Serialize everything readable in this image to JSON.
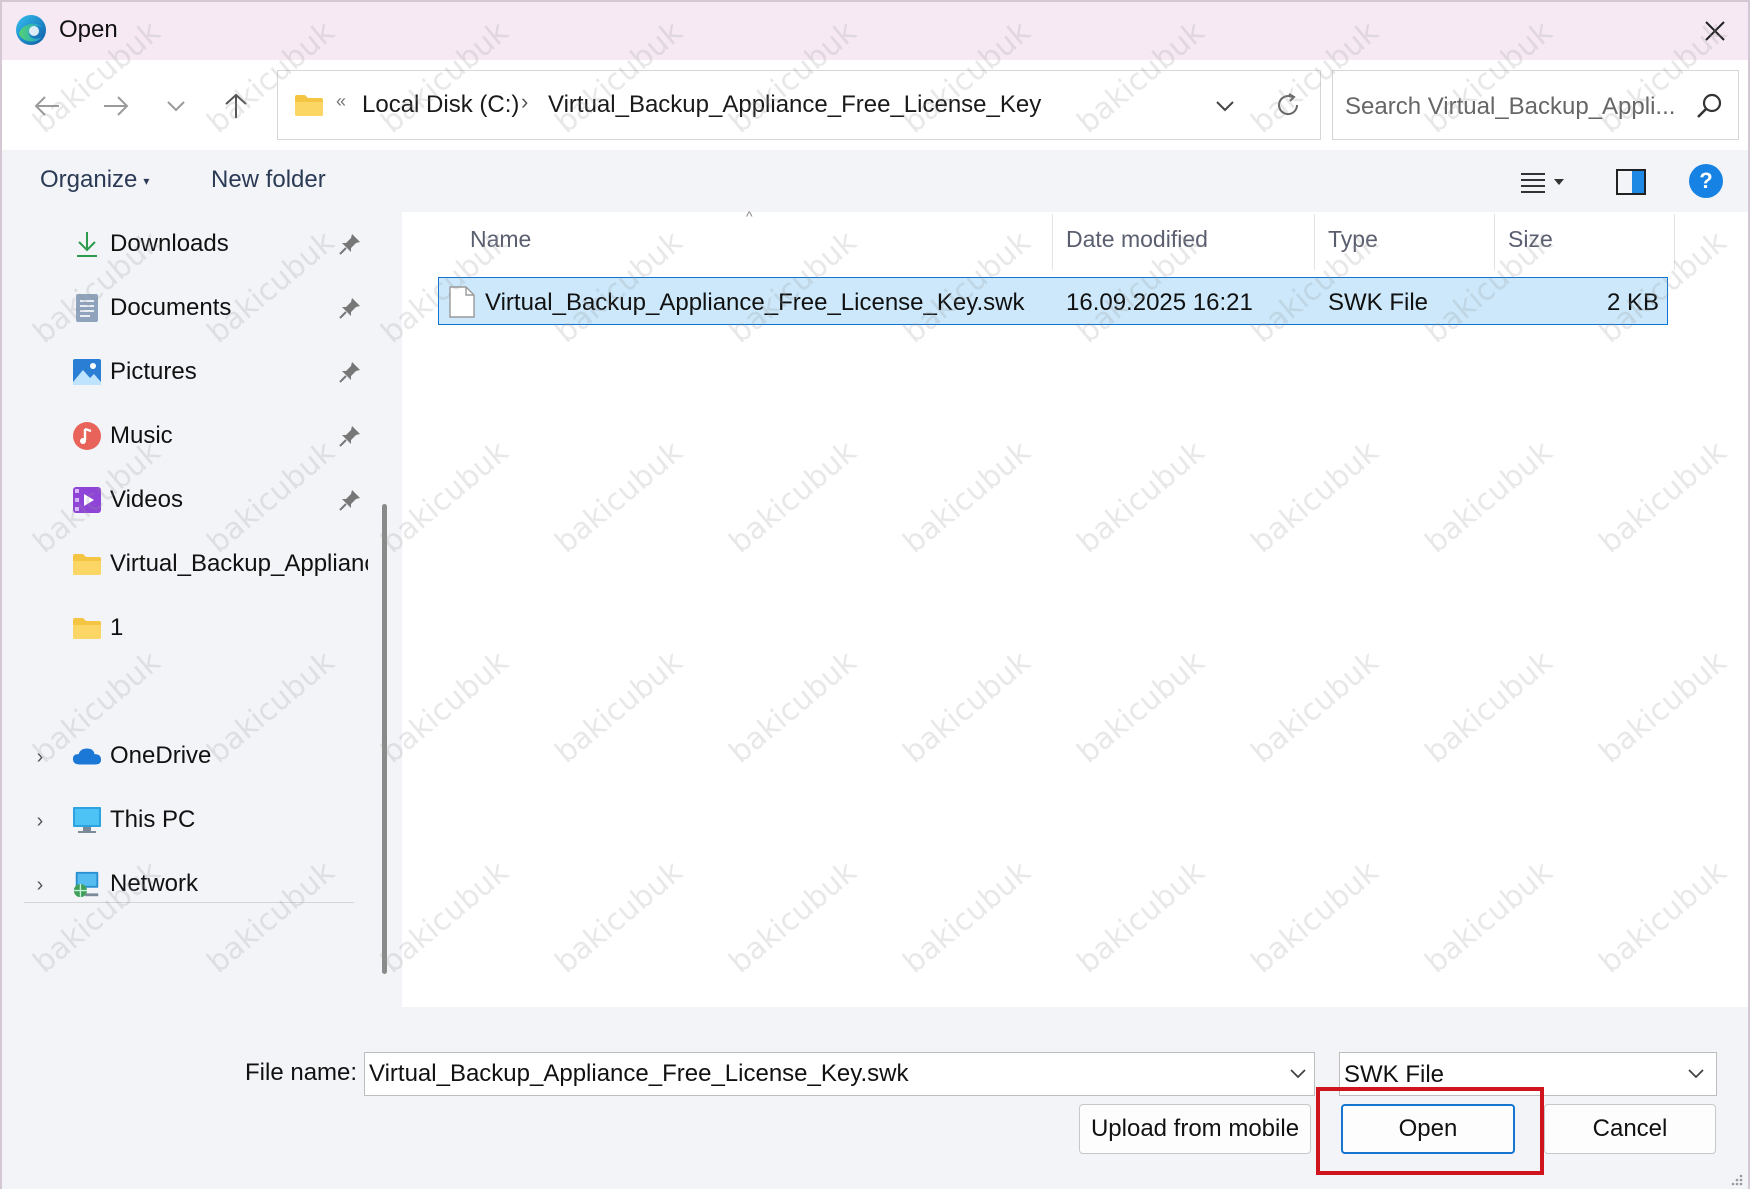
{
  "window": {
    "title": "Open",
    "app_icon": "edge-browser-icon"
  },
  "nav": {
    "back_icon": "arrow-left-icon",
    "forward_icon": "arrow-right-icon",
    "recent_icon": "chevron-down-icon",
    "up_icon": "arrow-up-icon"
  },
  "address": {
    "overflow": "«",
    "crumbs": [
      "Local Disk (C:)",
      "Virtual_Backup_Appliance_Free_License_Key"
    ],
    "separator": "›"
  },
  "search": {
    "placeholder": "Search Virtual_Backup_Appli..."
  },
  "toolbar": {
    "organize_label": "Organize",
    "organize_caret": "▾",
    "new_folder_label": "New folder",
    "help_label": "?"
  },
  "sidebar": {
    "quick_access": [
      {
        "label": "Downloads",
        "icon": "download-icon",
        "pinned": true
      },
      {
        "label": "Documents",
        "icon": "documents-icon",
        "pinned": true
      },
      {
        "label": "Pictures",
        "icon": "pictures-icon",
        "pinned": true
      },
      {
        "label": "Music",
        "icon": "music-icon",
        "pinned": true
      },
      {
        "label": "Videos",
        "icon": "videos-icon",
        "pinned": true
      },
      {
        "label": "Virtual_Backup_Applianc",
        "icon": "folder-icon",
        "pinned": false
      },
      {
        "label": "1",
        "icon": "folder-icon",
        "pinned": false
      }
    ],
    "locations": [
      {
        "label": "OneDrive",
        "icon": "onedrive-icon"
      },
      {
        "label": "This PC",
        "icon": "this-pc-icon"
      },
      {
        "label": "Network",
        "icon": "network-icon"
      }
    ],
    "expander": "›"
  },
  "files": {
    "columns": [
      "Name",
      "Date modified",
      "Type",
      "Size"
    ],
    "sort_indicator": "^",
    "rows": [
      {
        "name": "Virtual_Backup_Appliance_Free_License_Key.swk",
        "date": "16.09.2025 16:21",
        "type": "SWK File",
        "size": "2 KB",
        "selected": true
      }
    ]
  },
  "footer": {
    "file_name_label": "File name:",
    "file_name_value": "Virtual_Backup_Appliance_Free_License_Key.swk",
    "file_type_value": "SWK File",
    "upload_label": "Upload from mobile",
    "open_label": "Open",
    "cancel_label": "Cancel"
  },
  "watermark": "bakicubuk",
  "colors": {
    "accent": "#0d74d1",
    "selection": "#cce8fa",
    "highlight_box": "#d0141e",
    "titlebar": "#f6e9f4"
  }
}
